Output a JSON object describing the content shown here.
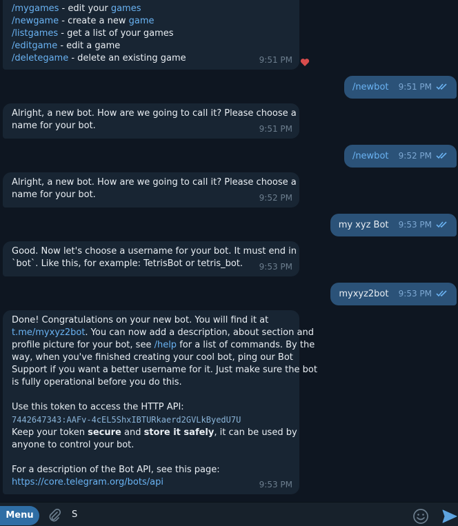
{
  "messages": [
    {
      "id": "m1",
      "dir": "in",
      "lines": [
        [
          {
            "t": "/mygames",
            "c": "cmd"
          },
          {
            "t": " - edit your "
          },
          {
            "t": "games",
            "c": "link"
          }
        ],
        [
          {
            "t": "/newgame",
            "c": "cmd"
          },
          {
            "t": " - create a new "
          },
          {
            "t": "game",
            "c": "link"
          }
        ],
        [
          {
            "t": "/listgames",
            "c": "cmd"
          },
          {
            "t": " - get a list of your games"
          }
        ],
        [
          {
            "t": "/editgame",
            "c": "cmd"
          },
          {
            "t": " - edit a game"
          }
        ],
        [
          {
            "t": "/deletegame",
            "c": "cmd"
          },
          {
            "t": " - delete an existing game"
          }
        ]
      ],
      "time": "9:51 PM",
      "reaction": "heart"
    },
    {
      "id": "m2",
      "dir": "out",
      "lines": [
        [
          {
            "t": "/newbot",
            "c": "cmd"
          }
        ]
      ],
      "time": "9:51 PM"
    },
    {
      "id": "m3",
      "dir": "in",
      "lines": [
        [
          {
            "t": "Alright, a new bot. How are we going to call it? Please choose a"
          }
        ],
        [
          {
            "t": "name for your bot."
          }
        ]
      ],
      "time": "9:51 PM"
    },
    {
      "id": "m4",
      "dir": "out",
      "lines": [
        [
          {
            "t": "/newbot",
            "c": "cmd"
          }
        ]
      ],
      "time": "9:52 PM"
    },
    {
      "id": "m5",
      "dir": "in",
      "lines": [
        [
          {
            "t": "Alright, a new bot. How are we going to call it? Please choose a"
          }
        ],
        [
          {
            "t": "name for your bot."
          }
        ]
      ],
      "time": "9:52 PM"
    },
    {
      "id": "m6",
      "dir": "out",
      "lines": [
        [
          {
            "t": "my xyz Bot"
          }
        ]
      ],
      "time": "9:53 PM"
    },
    {
      "id": "m7",
      "dir": "in",
      "lines": [
        [
          {
            "t": "Good. Now let's choose a username for your bot. It must end in"
          }
        ],
        [
          {
            "t": "`bot`. Like this, for example: TetrisBot or tetris_bot."
          }
        ]
      ],
      "time": "9:53 PM"
    },
    {
      "id": "m8",
      "dir": "out",
      "lines": [
        [
          {
            "t": "myxyz2bot"
          }
        ]
      ],
      "time": "9:53 PM"
    },
    {
      "id": "m9",
      "dir": "in",
      "lines": [
        [
          {
            "t": "Done! Congratulations on your new bot. You will find it at"
          }
        ],
        [
          {
            "t": "t.me/myxyz2bot",
            "c": "link"
          },
          {
            "t": ". You can now add a description, about section and"
          }
        ],
        [
          {
            "t": "profile picture for your bot, see "
          },
          {
            "t": "/help",
            "c": "cmd"
          },
          {
            "t": " for a list of commands. By the"
          }
        ],
        [
          {
            "t": "way, when you've finished creating your cool bot, ping our Bot"
          }
        ],
        [
          {
            "t": "Support if you want a better username for it. Just make sure the bot"
          }
        ],
        [
          {
            "t": "is fully operational before you do this."
          }
        ],
        [
          {
            "t": ""
          }
        ],
        [
          {
            "t": "Use this token to access the HTTP API:"
          }
        ],
        [
          {
            "t": "7442647343:AAFv-4cEL5ShxIBTURkaerd2GVLkByedU7U",
            "c": "mono"
          }
        ],
        [
          {
            "t": "Keep your token "
          },
          {
            "t": "secure",
            "c": "bold"
          },
          {
            "t": " and "
          },
          {
            "t": "store it safely",
            "c": "bold"
          },
          {
            "t": ", it can be used by"
          }
        ],
        [
          {
            "t": "anyone to control your bot."
          }
        ],
        [
          {
            "t": ""
          }
        ],
        [
          {
            "t": "For a description of the Bot API, see this page:"
          }
        ],
        [
          {
            "t": "https://core.telegram.org/bots/api",
            "c": "link"
          }
        ]
      ],
      "time": "9:53 PM"
    }
  ],
  "composer": {
    "menu_label": "Menu",
    "text": "S"
  },
  "colors": {
    "background": "#0e1621",
    "incoming_bubble": "#182533",
    "outgoing_bubble": "#2b5278",
    "link": "#6ab3f3",
    "menu_button": "#2f6ea5",
    "heart": "#d84c4c"
  },
  "icons": [
    "heart-icon",
    "double-check-icon",
    "paperclip-icon",
    "emoji-icon",
    "send-icon"
  ]
}
